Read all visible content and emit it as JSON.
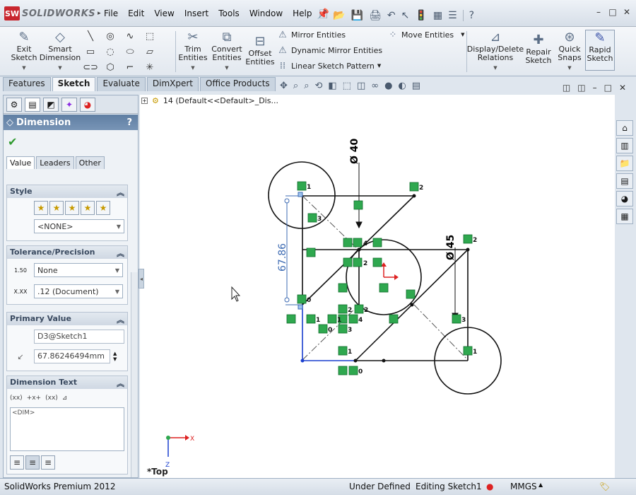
{
  "app": {
    "brand": "SOLIDWORKS",
    "logo_text": "SW"
  },
  "menu": [
    "File",
    "Edit",
    "View",
    "Insert",
    "Tools",
    "Window",
    "Help"
  ],
  "toolbar": {
    "exit_sketch": "Exit\nSketch",
    "smart_dimension": "Smart\nDimension",
    "trim_entities": "Trim\nEntities",
    "convert_entities": "Convert\nEntities",
    "offset_entities": "Offset\nEntities",
    "mirror_entities": "Mirror Entities",
    "dynamic_mirror": "Dynamic Mirror Entities",
    "linear_pattern": "Linear Sketch Pattern",
    "move_entities": "Move Entities",
    "display_delete_relations": "Display/Delete\nRelations",
    "repair_sketch": "Repair\nSketch",
    "quick_snaps": "Quick\nSnaps",
    "rapid_sketch": "Rapid\nSketch"
  },
  "cmd_tabs": [
    "Features",
    "Sketch",
    "Evaluate",
    "DimXpert",
    "Office Products"
  ],
  "active_cmd_tab": "Sketch",
  "tree": {
    "label": "14  (Default<<Default>_Dis..."
  },
  "property_manager": {
    "title": "Dimension",
    "help": "?",
    "tabs": [
      "Value",
      "Leaders",
      "Other"
    ],
    "style": {
      "header": "Style",
      "favorite": "<NONE>"
    },
    "tolerance": {
      "header": "Tolerance/Precision",
      "tolerance_type": "None",
      "precision": ".12 (Document)",
      "tol_icon": "1.50",
      "prec_icon": "X.XX"
    },
    "primary_value": {
      "header": "Primary Value",
      "name": "D3@Sketch1",
      "value": "67.86246494mm"
    },
    "dimension_text": {
      "header": "Dimension Text",
      "text": "<DIM>",
      "buttons": [
        "(xx)",
        "+x+",
        "(xx)"
      ]
    }
  },
  "drawing": {
    "dim_diameter_1": "Ø 40",
    "dim_diameter_2": "Ø 45",
    "dim_linear": "67.86",
    "axis_x": "X",
    "axis_z": "Z",
    "relation_labels": [
      "1",
      "2",
      "3",
      "4",
      "0"
    ]
  },
  "view_label": "*Top",
  "status": {
    "product": "SolidWorks Premium 2012",
    "definition": "Under Defined",
    "editing": "Editing Sketch1",
    "units": "MMGS"
  },
  "colors": {
    "pm_header": "#5f7ea3",
    "relation_green": "#2fa84f",
    "dimension_blue": "#3d6bb3",
    "selected_blue": "#1a3fcf"
  }
}
